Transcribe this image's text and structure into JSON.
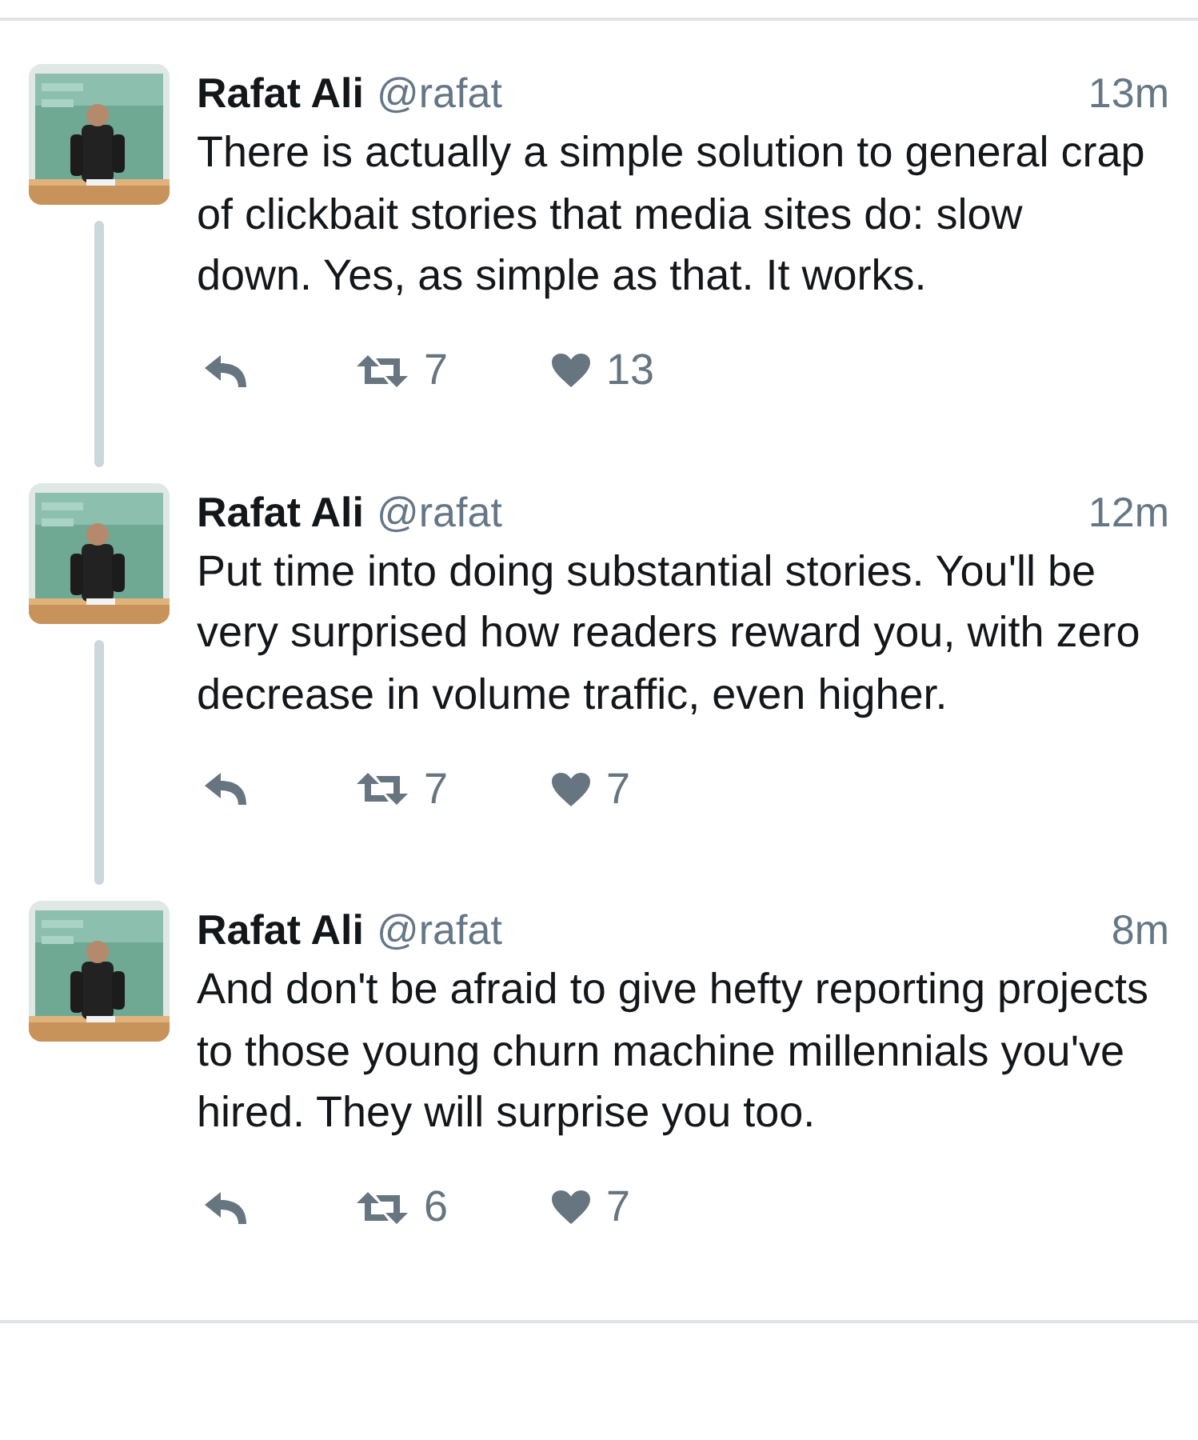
{
  "tweets": [
    {
      "name": "Rafat Ali",
      "handle": "@rafat",
      "time": "13m",
      "text": "There is actually a simple solution to general crap of clickbait stories that media sites do: slow down. Yes, as simple as that. It works.",
      "retweets": "7",
      "likes": "13",
      "thread_continues": true
    },
    {
      "name": "Rafat Ali",
      "handle": "@rafat",
      "time": "12m",
      "text": "Put time into doing substantial stories. You'll be very surprised how readers reward you, with zero decrease in volume traffic, even higher.",
      "retweets": "7",
      "likes": "7",
      "thread_continues": true
    },
    {
      "name": "Rafat Ali",
      "handle": "@rafat",
      "time": "8m",
      "text": "And don't be afraid to give hefty reporting projects to those young churn machine millennials you've hired. They will surprise you too.",
      "retweets": "6",
      "likes": "7",
      "thread_continues": false
    }
  ]
}
